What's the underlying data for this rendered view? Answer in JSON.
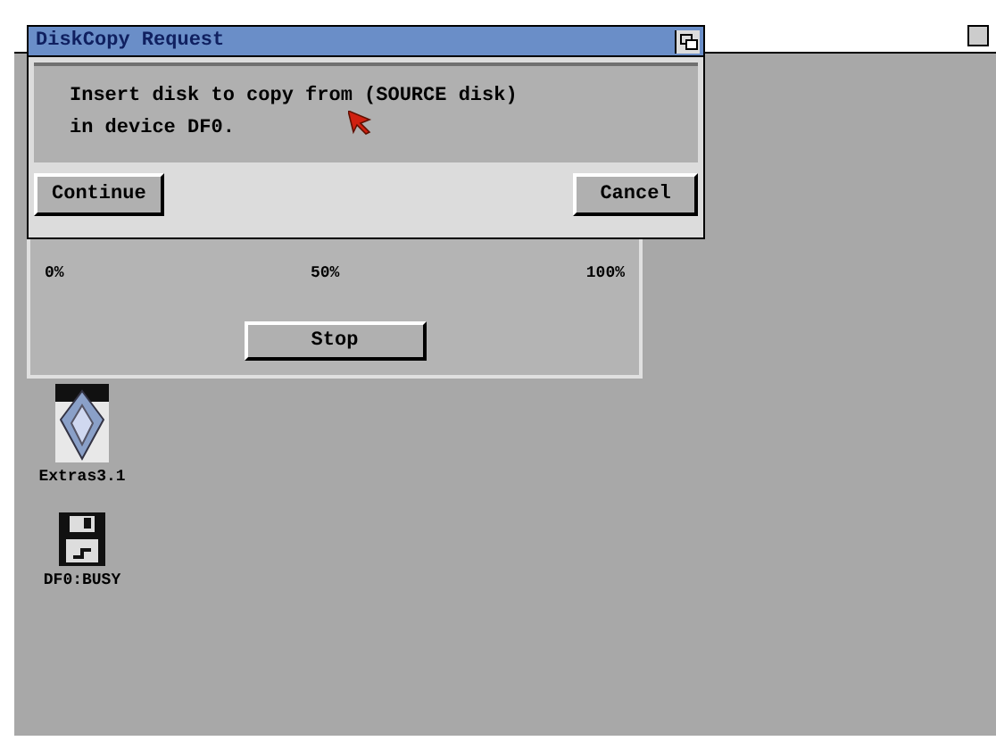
{
  "progress_window": {
    "scale_labels": [
      "0%",
      "50%",
      "100%"
    ],
    "stop_button": "Stop"
  },
  "requester": {
    "title": "DiskCopy Request",
    "message_lines": [
      "Insert disk to copy from (SOURCE disk)",
      "in device DF0."
    ],
    "buttons": [
      "Continue",
      "Cancel"
    ]
  },
  "desktop_icons": [
    {
      "kind": "drawer",
      "label": "Extras3.1"
    },
    {
      "kind": "disk",
      "label": "DF0:BUSY"
    }
  ]
}
